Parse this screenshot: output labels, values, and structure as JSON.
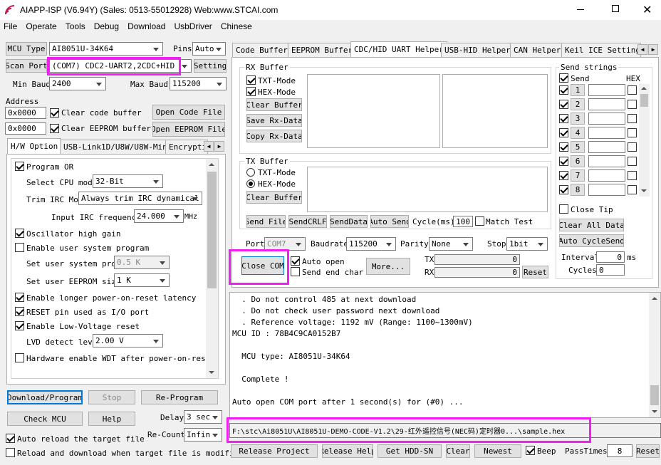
{
  "title": "AIAPP-ISP (V6.94Y) (Sales: 0513-55012928) Web:www.STCAI.com",
  "menu": [
    "File",
    "Operate",
    "Tools",
    "Debug",
    "Download",
    "UsbDriver",
    "Chinese"
  ],
  "left": {
    "mcu_type_btn": "MCU Type",
    "mcu_type": "AI8051U-34K64",
    "pins_label": "Pins",
    "pins": "Auto",
    "scan_port_btn": "Scan Port",
    "port": "(COM7) CDC2-UART2,2CDC+HID",
    "setting_btn": "Setting",
    "min_baud_label": "Min Baud",
    "min_baud": "2400",
    "max_baud_label": "Max Baud",
    "max_baud": "115200",
    "address_label": "Address",
    "addr1": "0x0000",
    "addr2": "0x0000",
    "clear_code": "Clear code buffer",
    "clear_eeprom": "Clear EEPROM buffer",
    "open_code_btn": "Open Code File",
    "open_eeprom_btn": "Open EEPROM File",
    "tabs": [
      "H/W Option",
      "USB-Link1D/U8W/U8W-Mini",
      "Encrypti"
    ],
    "options": {
      "program_or": "Program OR",
      "cpu_mode_label": "Select CPU mode",
      "cpu_mode": "32-Bit",
      "irc_label": "Trim IRC Mo",
      "irc": "Always trim IRC dynamical",
      "irc_freq_label": "Input IRC frequency",
      "irc_freq": "24.000",
      "irc_unit": "MHz",
      "osc": "Oscillator high gain",
      "user_sys": "Enable user system program",
      "user_sys_prog_label": "Set user system prog",
      "user_sys_prog": "0.5 K",
      "eeprom_label": "Set user EEPROM size",
      "eeprom": "1  K",
      "longer_reset": "Enable longer power-on-reset latency",
      "reset_io": "RESET pin used as I/O port",
      "low_volt": "Enable Low-Voltage reset",
      "lvd_label": "LVD detect leve",
      "lvd": "2.00 V",
      "wdt": "Hardware enable WDT after power-on-reset"
    },
    "download_btn": "Download/Program",
    "stop_btn": "Stop",
    "reprogram_btn": "Re-Program",
    "check_mcu_btn": "Check MCU",
    "help_btn": "Help",
    "delay_label": "Delay",
    "delay": "3 sec",
    "auto_reload": "Auto reload the target file",
    "recount_label": "Re-Count",
    "recount": "Infin",
    "reload_download": "Reload and download when target file is modified"
  },
  "right": {
    "tabs": [
      "Code Buffer",
      "EEPROM Buffer",
      "CDC/HID UART Helper",
      "USB-HID Helper",
      "CAN Helper",
      "Keil ICE Settings"
    ],
    "rx_title": "RX Buffer",
    "txt_mode": "TXT-Mode",
    "hex_mode": "HEX-Mode",
    "clear_buffer": "Clear Buffer",
    "save_rx": "Save Rx-Data",
    "copy_rx": "Copy Rx-Data",
    "tx_title": "TX Buffer",
    "send_file": "Send File",
    "send_crlf": "SendCRLF",
    "send_data": "SendData",
    "auto_send": "Auto Send",
    "cycle_label": "Cycle(ms)",
    "cycle": "100",
    "match_test": "Match Test",
    "send_strings_title": "Send strings",
    "send_col": "Send",
    "hex_col": "HEX",
    "send_rows": [
      "1",
      "2",
      "3",
      "4",
      "5",
      "6",
      "7",
      "8"
    ],
    "close_tip": "Close Tip",
    "clear_all": "Clear All Data",
    "auto_cycle": "Auto CycleSend",
    "interval_label": "Interval",
    "interval": "0",
    "interval_unit": "ms",
    "cycles_label": "Cycles",
    "cycles": "0",
    "port_label": "Port",
    "port": "COM7",
    "baud_label": "Baudrate",
    "baud": "115200",
    "parity_label": "Parity",
    "parity": "None",
    "stop_label": "Stop",
    "stop": "1bit",
    "close_com": "Close COM",
    "auto_open": "Auto open",
    "send_end": "Send end char",
    "more": "More...",
    "tx_label": "TX",
    "tx_val": "0",
    "rx_label": "RX",
    "rx_val": "0",
    "reset": "Reset"
  },
  "log": [
    "  . Do not control 485 at next download",
    "  . Do not check user password next download",
    "  . Reference voltage: 1192 mV (Range: 1100~1300mV)",
    "MCU ID : 78B4C9CA0152B7",
    "",
    "  MCU type: AI8051U-34K64",
    "",
    "  Complete !",
    "",
    "Auto open COM port after 1 second(s) for (#0) ..."
  ],
  "file_path": "F:\\stc\\Ai8051U\\AI8051U-DEMO-CODE-V1.2\\29-红外遥控信号(NEC码)定时器0...\\sample.hex",
  "bottom": {
    "release_project": "Release Project",
    "release_help": "Release Help",
    "get_hdd": "Get HDD-SN",
    "clear": "Clear",
    "newest": "Newest",
    "beep": "Beep",
    "pass_label": "PassTimes",
    "pass": "8",
    "reset": "Reset"
  },
  "colors": {
    "highlight": "#f01ef0",
    "title_icon": "#c2185b"
  }
}
